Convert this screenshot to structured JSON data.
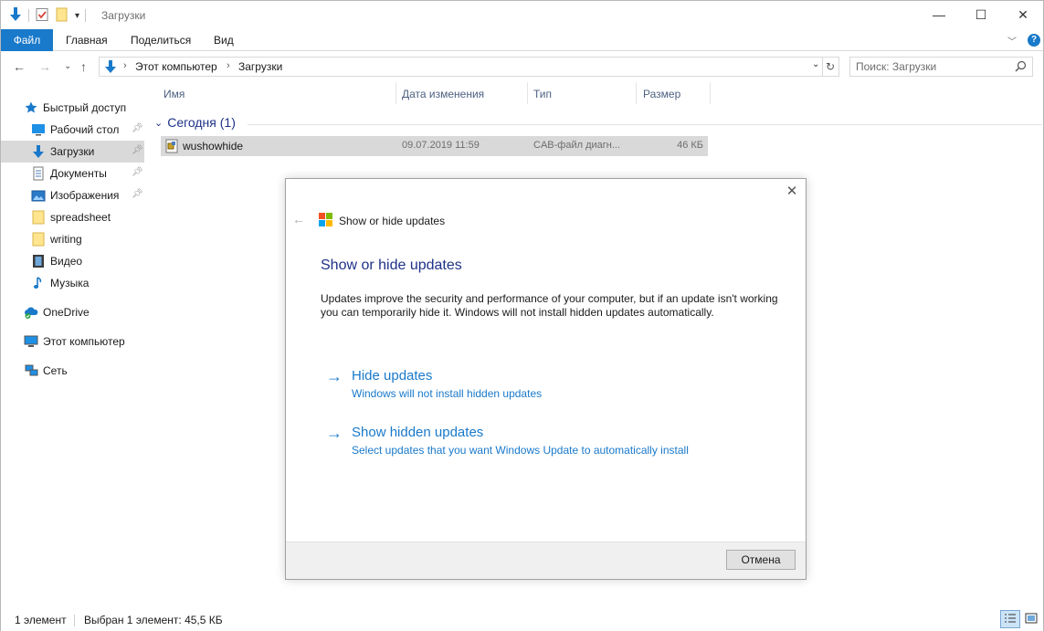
{
  "window": {
    "title": "Загрузки",
    "controls": {
      "minimize": "—",
      "maximize": "☐",
      "close": "✕"
    }
  },
  "ribbon": {
    "tabs": [
      "Файл",
      "Главная",
      "Поделиться",
      "Вид"
    ],
    "help": "?"
  },
  "address": {
    "crumbs": [
      "Этот компьютер",
      "Загрузки"
    ],
    "search_placeholder": "Поиск: Загрузки"
  },
  "sidebar": {
    "items": [
      {
        "label": "Быстрый доступ",
        "icon": "star-icon"
      },
      {
        "label": "Рабочий стол",
        "icon": "desktop-icon",
        "pinned": true
      },
      {
        "label": "Загрузки",
        "icon": "download-icon",
        "pinned": true,
        "selected": true
      },
      {
        "label": "Документы",
        "icon": "documents-icon",
        "pinned": true
      },
      {
        "label": "Изображения",
        "icon": "pictures-icon",
        "pinned": true
      },
      {
        "label": "spreadsheet",
        "icon": "folder-icon"
      },
      {
        "label": "writing",
        "icon": "folder-icon"
      },
      {
        "label": "Видео",
        "icon": "video-icon"
      },
      {
        "label": "Музыка",
        "icon": "music-icon"
      },
      {
        "label": "OneDrive",
        "icon": "onedrive-icon"
      },
      {
        "label": "Этот компьютер",
        "icon": "computer-icon"
      },
      {
        "label": "Сеть",
        "icon": "network-icon"
      }
    ]
  },
  "files": {
    "columns": [
      "Имя",
      "Дата изменения",
      "Тип",
      "Размер"
    ],
    "group": "Сегодня (1)",
    "rows": [
      {
        "name": "wushowhide",
        "date": "09.07.2019 11:59",
        "type": "CAB-файл диагн...",
        "size": "46 КБ"
      }
    ]
  },
  "status": {
    "count": "1 элемент",
    "selection": "Выбран 1 элемент: 45,5 КБ"
  },
  "dialog": {
    "app_title": "Show or hide updates",
    "heading": "Show or hide updates",
    "description": "Updates improve the security and performance of your computer, but if an update isn't working you can temporarily hide it. Windows will not install hidden updates automatically.",
    "options": [
      {
        "title": "Hide updates",
        "subtitle": "Windows will not install hidden updates"
      },
      {
        "title": "Show hidden updates",
        "subtitle": "Select updates that you want Windows Update to automatically install"
      }
    ],
    "cancel": "Отмена"
  },
  "colors": {
    "accent": "#1979ca",
    "heading": "#1e3287",
    "selection": "#d9d9d9"
  }
}
